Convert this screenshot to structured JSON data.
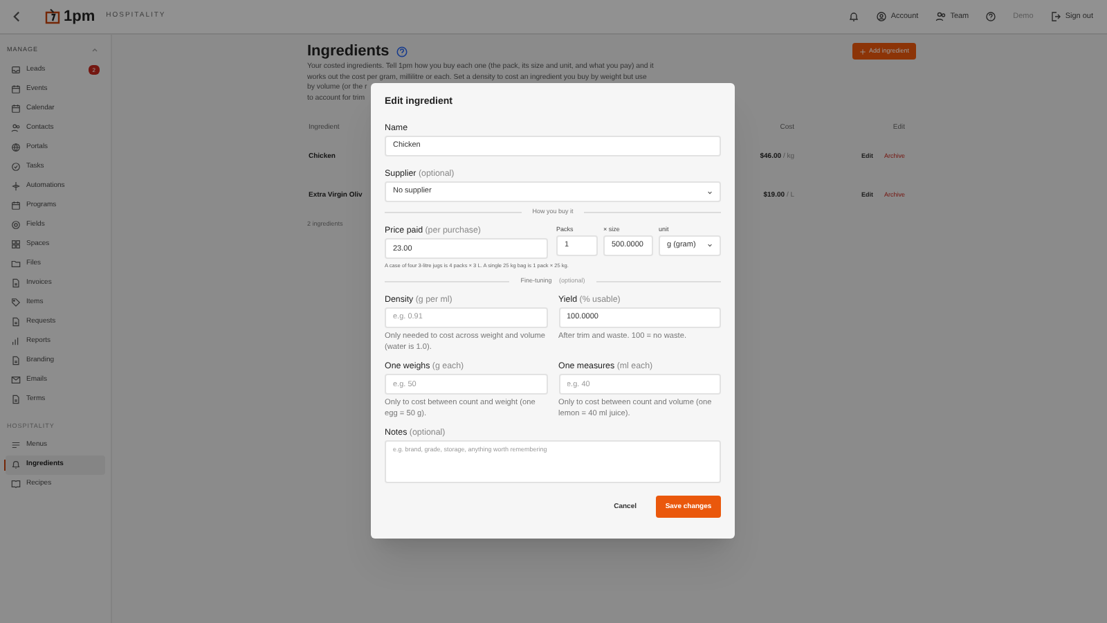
{
  "topbar": {
    "brand": "1pm",
    "subtitle": "HOSPITALITY",
    "actions": [
      {
        "kind": "bell",
        "disabled": false
      },
      {
        "kind": "account",
        "label": "Account",
        "disabled": false
      },
      {
        "kind": "team",
        "label": "Team",
        "disabled": false
      },
      {
        "kind": "help",
        "disabled": false
      },
      {
        "kind": "text",
        "label": "Demo",
        "disabled": true
      },
      {
        "kind": "signout",
        "label": "Sign out",
        "disabled": false
      }
    ]
  },
  "sidebar": {
    "sections": [
      {
        "title": "MANAGE",
        "collapsible": true,
        "items": [
          {
            "label": "Leads",
            "badge": "2",
            "selected": false
          },
          {
            "label": "Events",
            "selected": false
          },
          {
            "label": "Calendar",
            "selected": false
          },
          {
            "label": "Contacts",
            "selected": false
          },
          {
            "label": "Portals",
            "selected": false
          },
          {
            "label": "Tasks",
            "selected": false
          },
          {
            "label": "Automations",
            "selected": false
          },
          {
            "label": "Programs",
            "selected": false
          },
          {
            "label": "Fields",
            "selected": false
          },
          {
            "label": "Spaces",
            "selected": false
          },
          {
            "label": "Files",
            "selected": false
          },
          {
            "label": "Invoices",
            "selected": false
          },
          {
            "label": "Items",
            "selected": false
          },
          {
            "label": "Requests",
            "selected": false
          },
          {
            "label": "Reports",
            "selected": false
          },
          {
            "label": "Branding",
            "selected": false
          },
          {
            "label": "Emails",
            "selected": false
          },
          {
            "label": "Terms",
            "selected": false
          }
        ]
      },
      {
        "title": "HOSPITALITY",
        "collapsible": false,
        "items": [
          {
            "label": "Menus",
            "selected": false
          },
          {
            "label": "Ingredients",
            "selected": true
          },
          {
            "label": "Recipes",
            "selected": false
          }
        ]
      }
    ]
  },
  "page": {
    "title": "Ingredients",
    "add_button": "Add ingredient",
    "intro_lines": [
      "Your costed ingredients. Tell 1pm how you buy each one (the pack, its size and unit, and what you pay) and it",
      "works out the cost per gram, millilitre or each. Set a density to cost an ingredient you buy by weight but use",
      "by volume (or the r",
      "to account for trim"
    ],
    "table": {
      "columns": [
        "Ingredient",
        "Cost",
        "Edit"
      ],
      "rows": [
        {
          "ingredient": "Chicken",
          "cost": "$46.00",
          "unit": "/ kg",
          "edit": "Edit",
          "archive": "Archive"
        },
        {
          "ingredient": "Extra Virgin Oliv",
          "cost": "$19.00",
          "unit": "/ L",
          "edit": "Edit",
          "archive": "Archive"
        }
      ]
    },
    "count": "2 ingredients"
  },
  "modal": {
    "title": "Edit ingredient",
    "name": {
      "label": "Name",
      "value": "Chicken"
    },
    "supplier": {
      "label": "Supplier",
      "note": "(optional)",
      "value": "No supplier"
    },
    "divider_1": "How you buy it",
    "price": {
      "label": "Price paid",
      "note": "(per purchase)",
      "value": "23.00"
    },
    "packs": {
      "label": "Packs",
      "value": "1"
    },
    "size": {
      "label": "× size",
      "value": "500.0000"
    },
    "unit": {
      "label": "unit",
      "value": "g (gram)"
    },
    "price_hint": "A case of four 3-litre jugs is 4 packs × 3 L. A single 25 kg bag is 1 pack × 25 kg.",
    "divider_2": {
      "label": "Fine-tuning",
      "note": "(optional)"
    },
    "pairs": [
      {
        "label": "Density",
        "note": "(g per ml)",
        "placeholder": "e.g. 0.91",
        "help": "Only needed to cost across weight and volume (water is 1.0)."
      },
      {
        "label": "Yield",
        "note": "(% usable)",
        "value": "100.0000",
        "help": "After trim and waste. 100 = no waste."
      },
      {
        "label": "One weighs",
        "note": "(g each)",
        "placeholder": "e.g. 50",
        "help": "Only to cost between count and weight (one egg = 50 g)."
      },
      {
        "label": "One measures",
        "note": "(ml each)",
        "placeholder": "e.g. 40",
        "help": "Only to cost between count and volume (one lemon = 40 ml juice)."
      }
    ],
    "notes": {
      "label": "Notes",
      "note": "(optional)",
      "placeholder": "e.g. brand, grade, storage, anything worth remembering"
    },
    "cancel": "Cancel",
    "save": "Save changes"
  }
}
